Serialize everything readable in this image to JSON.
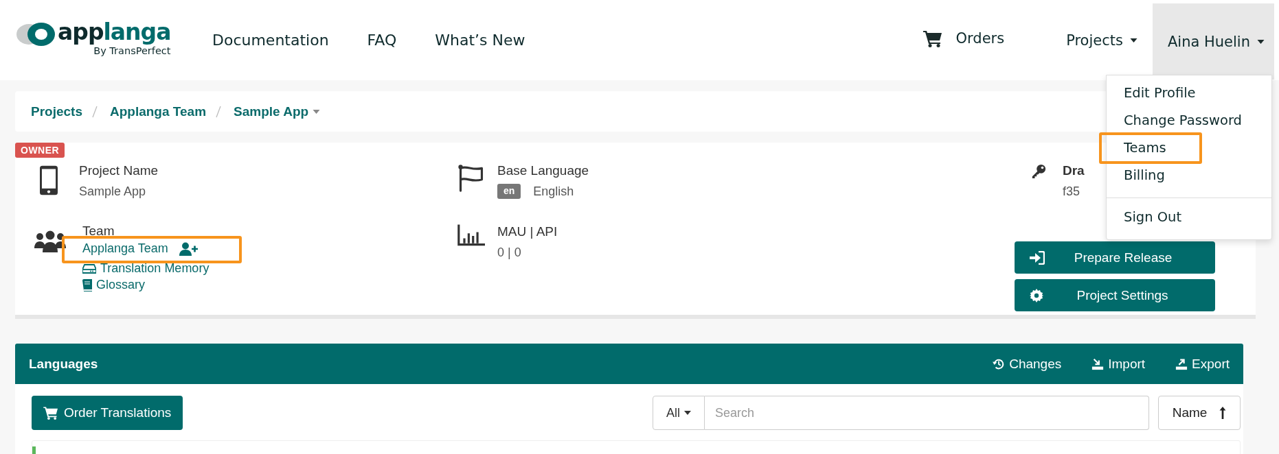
{
  "header": {
    "logo": {
      "wordmark_part_1": "app",
      "wordmark_part_2": "langa",
      "tagline": "By TransPerfect"
    },
    "nav": [
      "Documentation",
      "FAQ",
      "What’s New"
    ],
    "orders": "Orders",
    "projects_menu": "Projects",
    "user_menu": {
      "label": "Aina Huelin",
      "expanded": true,
      "items": [
        {
          "label": "Edit Profile",
          "highlighted": false,
          "divider_before": false
        },
        {
          "label": "Change Password",
          "highlighted": false,
          "divider_before": false
        },
        {
          "label": "Teams",
          "highlighted": true,
          "divider_before": false
        },
        {
          "label": "Billing",
          "highlighted": false,
          "divider_before": false
        },
        {
          "label": "Sign Out",
          "highlighted": false,
          "divider_before": true
        }
      ]
    }
  },
  "breadcrumb": [
    "Projects",
    "Applanga Team",
    "Sample App"
  ],
  "project": {
    "badge": "OWNER",
    "name_label": "Project Name",
    "name": "Sample App",
    "team_label": "Team",
    "team": {
      "label": "Applanga Team",
      "highlighted": true
    },
    "links": [
      {
        "label": "Translation Memory",
        "kind": "memory"
      },
      {
        "label": "Glossary",
        "kind": "glossary"
      }
    ],
    "base_language_label": "Base Language",
    "language_code": "en",
    "language": "English",
    "usage_label": "MAU | API",
    "usage": "0 | 0",
    "key_label": "Dra",
    "key": "f35",
    "buttons": [
      {
        "label": "Prepare Release",
        "kind": "release"
      },
      {
        "label": "Project Settings",
        "kind": "settings"
      }
    ]
  },
  "languages": {
    "title": "Languages",
    "actions": [
      {
        "label": "Changes",
        "kind": "history"
      },
      {
        "label": "Import",
        "kind": "import"
      },
      {
        "label": "Export",
        "kind": "export"
      }
    ],
    "order_button": "Order Translations",
    "filter": "All",
    "search": {
      "placeholder": "Search"
    },
    "sort": "Name"
  }
}
